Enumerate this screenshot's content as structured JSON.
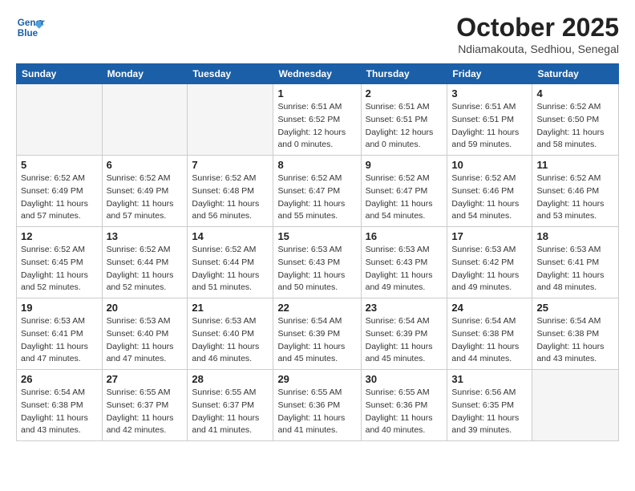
{
  "header": {
    "logo_line1": "General",
    "logo_line2": "Blue",
    "month": "October 2025",
    "location": "Ndiamakouta, Sedhiou, Senegal"
  },
  "weekdays": [
    "Sunday",
    "Monday",
    "Tuesday",
    "Wednesday",
    "Thursday",
    "Friday",
    "Saturday"
  ],
  "weeks": [
    [
      {
        "day": "",
        "info": ""
      },
      {
        "day": "",
        "info": ""
      },
      {
        "day": "",
        "info": ""
      },
      {
        "day": "1",
        "info": "Sunrise: 6:51 AM\nSunset: 6:52 PM\nDaylight: 12 hours\nand 0 minutes."
      },
      {
        "day": "2",
        "info": "Sunrise: 6:51 AM\nSunset: 6:51 PM\nDaylight: 12 hours\nand 0 minutes."
      },
      {
        "day": "3",
        "info": "Sunrise: 6:51 AM\nSunset: 6:51 PM\nDaylight: 11 hours\nand 59 minutes."
      },
      {
        "day": "4",
        "info": "Sunrise: 6:52 AM\nSunset: 6:50 PM\nDaylight: 11 hours\nand 58 minutes."
      }
    ],
    [
      {
        "day": "5",
        "info": "Sunrise: 6:52 AM\nSunset: 6:49 PM\nDaylight: 11 hours\nand 57 minutes."
      },
      {
        "day": "6",
        "info": "Sunrise: 6:52 AM\nSunset: 6:49 PM\nDaylight: 11 hours\nand 57 minutes."
      },
      {
        "day": "7",
        "info": "Sunrise: 6:52 AM\nSunset: 6:48 PM\nDaylight: 11 hours\nand 56 minutes."
      },
      {
        "day": "8",
        "info": "Sunrise: 6:52 AM\nSunset: 6:47 PM\nDaylight: 11 hours\nand 55 minutes."
      },
      {
        "day": "9",
        "info": "Sunrise: 6:52 AM\nSunset: 6:47 PM\nDaylight: 11 hours\nand 54 minutes."
      },
      {
        "day": "10",
        "info": "Sunrise: 6:52 AM\nSunset: 6:46 PM\nDaylight: 11 hours\nand 54 minutes."
      },
      {
        "day": "11",
        "info": "Sunrise: 6:52 AM\nSunset: 6:46 PM\nDaylight: 11 hours\nand 53 minutes."
      }
    ],
    [
      {
        "day": "12",
        "info": "Sunrise: 6:52 AM\nSunset: 6:45 PM\nDaylight: 11 hours\nand 52 minutes."
      },
      {
        "day": "13",
        "info": "Sunrise: 6:52 AM\nSunset: 6:44 PM\nDaylight: 11 hours\nand 52 minutes."
      },
      {
        "day": "14",
        "info": "Sunrise: 6:52 AM\nSunset: 6:44 PM\nDaylight: 11 hours\nand 51 minutes."
      },
      {
        "day": "15",
        "info": "Sunrise: 6:53 AM\nSunset: 6:43 PM\nDaylight: 11 hours\nand 50 minutes."
      },
      {
        "day": "16",
        "info": "Sunrise: 6:53 AM\nSunset: 6:43 PM\nDaylight: 11 hours\nand 49 minutes."
      },
      {
        "day": "17",
        "info": "Sunrise: 6:53 AM\nSunset: 6:42 PM\nDaylight: 11 hours\nand 49 minutes."
      },
      {
        "day": "18",
        "info": "Sunrise: 6:53 AM\nSunset: 6:41 PM\nDaylight: 11 hours\nand 48 minutes."
      }
    ],
    [
      {
        "day": "19",
        "info": "Sunrise: 6:53 AM\nSunset: 6:41 PM\nDaylight: 11 hours\nand 47 minutes."
      },
      {
        "day": "20",
        "info": "Sunrise: 6:53 AM\nSunset: 6:40 PM\nDaylight: 11 hours\nand 47 minutes."
      },
      {
        "day": "21",
        "info": "Sunrise: 6:53 AM\nSunset: 6:40 PM\nDaylight: 11 hours\nand 46 minutes."
      },
      {
        "day": "22",
        "info": "Sunrise: 6:54 AM\nSunset: 6:39 PM\nDaylight: 11 hours\nand 45 minutes."
      },
      {
        "day": "23",
        "info": "Sunrise: 6:54 AM\nSunset: 6:39 PM\nDaylight: 11 hours\nand 45 minutes."
      },
      {
        "day": "24",
        "info": "Sunrise: 6:54 AM\nSunset: 6:38 PM\nDaylight: 11 hours\nand 44 minutes."
      },
      {
        "day": "25",
        "info": "Sunrise: 6:54 AM\nSunset: 6:38 PM\nDaylight: 11 hours\nand 43 minutes."
      }
    ],
    [
      {
        "day": "26",
        "info": "Sunrise: 6:54 AM\nSunset: 6:38 PM\nDaylight: 11 hours\nand 43 minutes."
      },
      {
        "day": "27",
        "info": "Sunrise: 6:55 AM\nSunset: 6:37 PM\nDaylight: 11 hours\nand 42 minutes."
      },
      {
        "day": "28",
        "info": "Sunrise: 6:55 AM\nSunset: 6:37 PM\nDaylight: 11 hours\nand 41 minutes."
      },
      {
        "day": "29",
        "info": "Sunrise: 6:55 AM\nSunset: 6:36 PM\nDaylight: 11 hours\nand 41 minutes."
      },
      {
        "day": "30",
        "info": "Sunrise: 6:55 AM\nSunset: 6:36 PM\nDaylight: 11 hours\nand 40 minutes."
      },
      {
        "day": "31",
        "info": "Sunrise: 6:56 AM\nSunset: 6:35 PM\nDaylight: 11 hours\nand 39 minutes."
      },
      {
        "day": "",
        "info": ""
      }
    ]
  ]
}
